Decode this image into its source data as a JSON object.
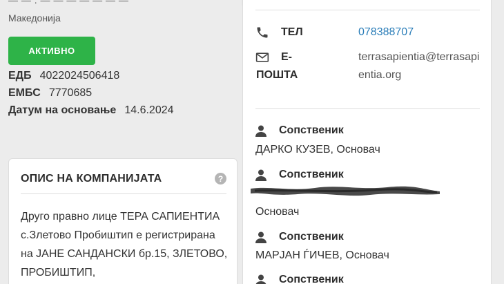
{
  "company": {
    "country": "Македонија",
    "status_button": "АКТИВНО",
    "registry": [
      {
        "label": "ЕДБ",
        "value": "4022024506418"
      },
      {
        "label": "ЕМБС",
        "value": "7770685"
      },
      {
        "label": "Датум на основање",
        "value": "14.6.2024"
      }
    ]
  },
  "description": {
    "title": "ОПИС НА КОМПАНИЈАТА",
    "help_icon": "question-circle-icon",
    "text": "Друго правно лице ТЕРА САПИЕНТИА с.Злетово Пробиштип е регистрирана на ЈАНЕ САНДАНСКИ бр.15, ЗЛЕТОВО, ПРОБИШТИП,"
  },
  "contact": {
    "phone_label": "ТЕЛ",
    "phone_value": "078388707",
    "email_label_1": "Е-",
    "email_label_2": "ПОШТА",
    "email_value": "terrasapientia@terrasapientia.org"
  },
  "owners": [
    {
      "label": "Сопственик",
      "text": "ДАРКО КУЗЕВ, Основач",
      "icon": "person-icon"
    },
    {
      "label": "Сопственик",
      "text": "Основач",
      "icon": "person-icon",
      "redacted": true
    },
    {
      "label": "Сопственик",
      "text": "МАРЈАН ЃИЧЕВ, Основач",
      "icon": "person-icon"
    }
  ],
  "colors": {
    "active_green": "#2eb348",
    "phone_link": "#2a7db8",
    "redaction": "#3a3a3a"
  }
}
